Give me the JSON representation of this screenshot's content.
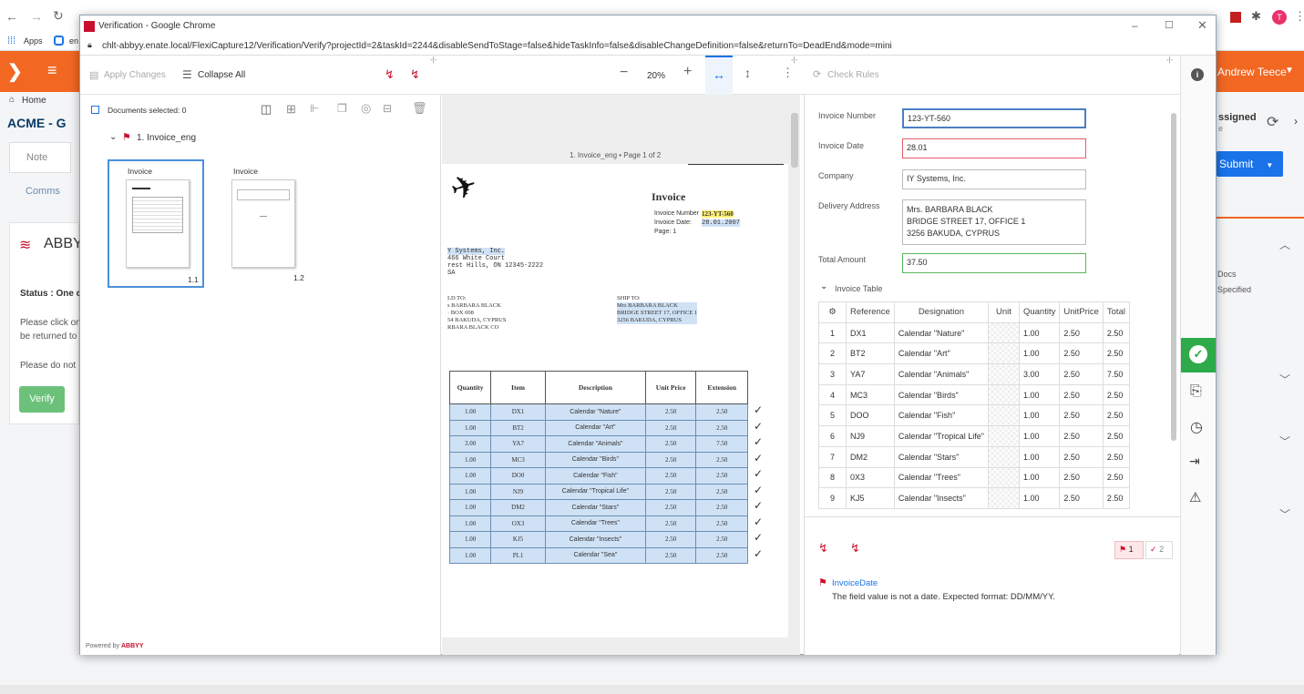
{
  "bg": {
    "bookmarks": [
      "Apps",
      "en"
    ],
    "home": "Home",
    "company": "ACME - G",
    "tabs": [
      "Note",
      "Comms"
    ],
    "card_title": "ABBY",
    "status": "Status : One c",
    "line1": "Please click on",
    "line2": "be returned to",
    "line3": "Please do not",
    "verify_label": "Verify",
    "user": "Andrew Teece",
    "assigned": "ssigned",
    "assigned_sub": "e",
    "submit_label": "Submit",
    "docs": "Docs",
    "specified": "Specified",
    "avatar": "T"
  },
  "window": {
    "title": "Verification - Google Chrome",
    "url": "chlt-abbyy.enate.local/FlexiCapture12/Verification/Verify?projectId=2&taskId=2244&disableSendToStage=false&hideTaskInfo=false&disableChangeDefinition=false&returnTo=DeadEnd&mode=mini"
  },
  "toolbar": {
    "apply_changes": "Apply Changes",
    "collapse_all": "Collapse All",
    "zoom": "20%",
    "check_rules": "Check Rules"
  },
  "left": {
    "docs_selected": "Documents selected: 0",
    "tree_item": "1. Invoice_eng",
    "thumbs": [
      {
        "label": "Invoice",
        "page": "1.1"
      },
      {
        "label": "Invoice",
        "page": "1.2"
      }
    ],
    "powered_by": "Powered by",
    "brand": "ABBYY"
  },
  "viewer": {
    "page_label": "1. Invoice_eng • Page 1 of 2",
    "doc_title": "Invoice",
    "invoice_number_label": "Invoice Number",
    "invoice_number": "123-YT-560",
    "invoice_date_label": "Invoice Date:",
    "invoice_date": "28.01.2007",
    "page_line": "Page: 1",
    "sender": [
      "Y Systems, Inc.",
      "466 White Court",
      "rest Hills, ON  12345-2222",
      "SA"
    ],
    "sold_to": [
      "LD TO:",
      "s BARBARA BLACK",
      "· BOX  008",
      "54 BAKUDA, CYPRUS",
      "RBARA BLACK CO"
    ],
    "ship_to": [
      "SHIP TO:",
      "Mrs BARBARA BLACK",
      "BRIDGE STREET 17, OFFICE 1",
      "3256  BAKUDA, CYPRUS"
    ],
    "columns": [
      "Quantity",
      "Item",
      "Description",
      "Unit Price",
      "Extension"
    ],
    "rows": [
      [
        "1.00",
        "DX1",
        "Calendar \"Nature\"",
        "2.50",
        "2.50"
      ],
      [
        "1.00",
        "BT2",
        "Calendar \"Art\"",
        "2.50",
        "2.50"
      ],
      [
        "3.00",
        "YA7",
        "Calendar \"Animals\"",
        "2.50",
        "7.50"
      ],
      [
        "1.00",
        "MC3",
        "Calendar \"Birds\"",
        "2.50",
        "2.50"
      ],
      [
        "1.00",
        "DO0",
        "Calendar \"Fish\"",
        "2.50",
        "2.50"
      ],
      [
        "1.00",
        "NJ9",
        "Calendar \"Tropical Life\"",
        "2.50",
        "2.50"
      ],
      [
        "1.00",
        "DM2",
        "Calendar \"Stars\"",
        "2.50",
        "2.50"
      ],
      [
        "1.00",
        "OX3",
        "Calendar \"Trees\"",
        "2.50",
        "2.50"
      ],
      [
        "1.00",
        "KJ5",
        "Calendar \"Insects\"",
        "2.50",
        "2.50"
      ],
      [
        "1.00",
        "PL1",
        "Calendar \"Sea\"",
        "2.50",
        "2.50"
      ]
    ]
  },
  "form": {
    "invoice_number_label": "Invoice Number",
    "invoice_number": "123-YT-560",
    "invoice_date_label": "Invoice Date",
    "invoice_date": "28.01",
    "company_label": "Company",
    "company": "IY Systems, Inc.",
    "address_label": "Delivery Address",
    "address_lines": [
      "Mrs. BARBARA BLACK",
      "BRIDGE STREET 17, OFFICE 1",
      "3256 BAKUDA, CYPRUS"
    ],
    "total_label": "Total Amount",
    "total": "37.50",
    "table_label": "Invoice Table",
    "columns": [
      "Reference",
      "Designation",
      "Unit",
      "Quantity",
      "UnitPrice",
      "Total"
    ],
    "rows": [
      [
        "1",
        "DX1",
        "Calendar \"Nature\"",
        "",
        "1.00",
        "2.50",
        "2.50"
      ],
      [
        "2",
        "BT2",
        "Calendar \"Art\"",
        "",
        "1.00",
        "2.50",
        "2.50"
      ],
      [
        "3",
        "YA7",
        "Calendar \"Animals\"",
        "",
        "3.00",
        "2.50",
        "7.50"
      ],
      [
        "4",
        "MC3",
        "Calendar \"Birds\"",
        "",
        "1.00",
        "2.50",
        "2.50"
      ],
      [
        "5",
        "DOO",
        "Calendar \"Fish\"",
        "",
        "1.00",
        "2.50",
        "2.50"
      ],
      [
        "6",
        "NJ9",
        "Calendar \"Tropical Life\"",
        "",
        "1.00",
        "2.50",
        "2.50"
      ],
      [
        "7",
        "DM2",
        "Calendar \"Stars\"",
        "",
        "1.00",
        "2.50",
        "2.50"
      ],
      [
        "8",
        "0X3",
        "Calendar \"Trees\"",
        "",
        "1.00",
        "2.50",
        "2.50"
      ],
      [
        "9",
        "KJ5",
        "Calendar \"Insects\"",
        "",
        "1.00",
        "2.50",
        "2.50"
      ]
    ],
    "error_count": "1",
    "ok_count": "2",
    "error_field": "InvoiceDate",
    "error_message": "The field value is not a date. Expected format: DD/MM/YY."
  },
  "colors": {
    "accent": "#1a73e8",
    "error": "#c8102e",
    "ok": "#28a745",
    "brand": "#f26722"
  }
}
